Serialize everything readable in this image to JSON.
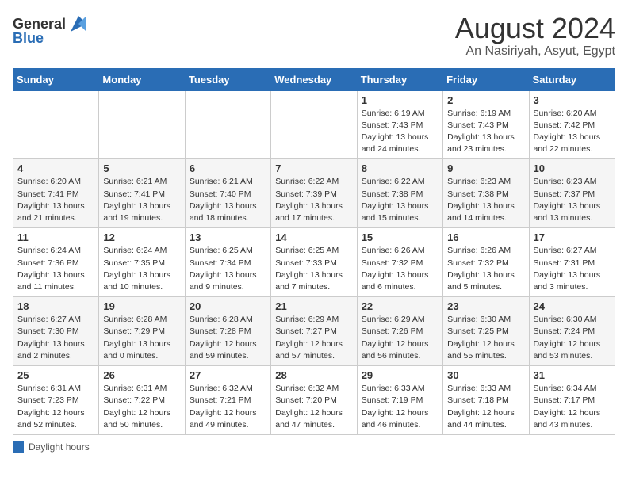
{
  "header": {
    "logo_general": "General",
    "logo_blue": "Blue",
    "month_year": "August 2024",
    "location": "An Nasiriyah, Asyut, Egypt"
  },
  "calendar": {
    "weekdays": [
      "Sunday",
      "Monday",
      "Tuesday",
      "Wednesday",
      "Thursday",
      "Friday",
      "Saturday"
    ],
    "weeks": [
      [
        {
          "day": "",
          "info": ""
        },
        {
          "day": "",
          "info": ""
        },
        {
          "day": "",
          "info": ""
        },
        {
          "day": "",
          "info": ""
        },
        {
          "day": "1",
          "info": "Sunrise: 6:19 AM\nSunset: 7:43 PM\nDaylight: 13 hours\nand 24 minutes."
        },
        {
          "day": "2",
          "info": "Sunrise: 6:19 AM\nSunset: 7:43 PM\nDaylight: 13 hours\nand 23 minutes."
        },
        {
          "day": "3",
          "info": "Sunrise: 6:20 AM\nSunset: 7:42 PM\nDaylight: 13 hours\nand 22 minutes."
        }
      ],
      [
        {
          "day": "4",
          "info": "Sunrise: 6:20 AM\nSunset: 7:41 PM\nDaylight: 13 hours\nand 21 minutes."
        },
        {
          "day": "5",
          "info": "Sunrise: 6:21 AM\nSunset: 7:41 PM\nDaylight: 13 hours\nand 19 minutes."
        },
        {
          "day": "6",
          "info": "Sunrise: 6:21 AM\nSunset: 7:40 PM\nDaylight: 13 hours\nand 18 minutes."
        },
        {
          "day": "7",
          "info": "Sunrise: 6:22 AM\nSunset: 7:39 PM\nDaylight: 13 hours\nand 17 minutes."
        },
        {
          "day": "8",
          "info": "Sunrise: 6:22 AM\nSunset: 7:38 PM\nDaylight: 13 hours\nand 15 minutes."
        },
        {
          "day": "9",
          "info": "Sunrise: 6:23 AM\nSunset: 7:38 PM\nDaylight: 13 hours\nand 14 minutes."
        },
        {
          "day": "10",
          "info": "Sunrise: 6:23 AM\nSunset: 7:37 PM\nDaylight: 13 hours\nand 13 minutes."
        }
      ],
      [
        {
          "day": "11",
          "info": "Sunrise: 6:24 AM\nSunset: 7:36 PM\nDaylight: 13 hours\nand 11 minutes."
        },
        {
          "day": "12",
          "info": "Sunrise: 6:24 AM\nSunset: 7:35 PM\nDaylight: 13 hours\nand 10 minutes."
        },
        {
          "day": "13",
          "info": "Sunrise: 6:25 AM\nSunset: 7:34 PM\nDaylight: 13 hours\nand 9 minutes."
        },
        {
          "day": "14",
          "info": "Sunrise: 6:25 AM\nSunset: 7:33 PM\nDaylight: 13 hours\nand 7 minutes."
        },
        {
          "day": "15",
          "info": "Sunrise: 6:26 AM\nSunset: 7:32 PM\nDaylight: 13 hours\nand 6 minutes."
        },
        {
          "day": "16",
          "info": "Sunrise: 6:26 AM\nSunset: 7:32 PM\nDaylight: 13 hours\nand 5 minutes."
        },
        {
          "day": "17",
          "info": "Sunrise: 6:27 AM\nSunset: 7:31 PM\nDaylight: 13 hours\nand 3 minutes."
        }
      ],
      [
        {
          "day": "18",
          "info": "Sunrise: 6:27 AM\nSunset: 7:30 PM\nDaylight: 13 hours\nand 2 minutes."
        },
        {
          "day": "19",
          "info": "Sunrise: 6:28 AM\nSunset: 7:29 PM\nDaylight: 13 hours\nand 0 minutes."
        },
        {
          "day": "20",
          "info": "Sunrise: 6:28 AM\nSunset: 7:28 PM\nDaylight: 12 hours\nand 59 minutes."
        },
        {
          "day": "21",
          "info": "Sunrise: 6:29 AM\nSunset: 7:27 PM\nDaylight: 12 hours\nand 57 minutes."
        },
        {
          "day": "22",
          "info": "Sunrise: 6:29 AM\nSunset: 7:26 PM\nDaylight: 12 hours\nand 56 minutes."
        },
        {
          "day": "23",
          "info": "Sunrise: 6:30 AM\nSunset: 7:25 PM\nDaylight: 12 hours\nand 55 minutes."
        },
        {
          "day": "24",
          "info": "Sunrise: 6:30 AM\nSunset: 7:24 PM\nDaylight: 12 hours\nand 53 minutes."
        }
      ],
      [
        {
          "day": "25",
          "info": "Sunrise: 6:31 AM\nSunset: 7:23 PM\nDaylight: 12 hours\nand 52 minutes."
        },
        {
          "day": "26",
          "info": "Sunrise: 6:31 AM\nSunset: 7:22 PM\nDaylight: 12 hours\nand 50 minutes."
        },
        {
          "day": "27",
          "info": "Sunrise: 6:32 AM\nSunset: 7:21 PM\nDaylight: 12 hours\nand 49 minutes."
        },
        {
          "day": "28",
          "info": "Sunrise: 6:32 AM\nSunset: 7:20 PM\nDaylight: 12 hours\nand 47 minutes."
        },
        {
          "day": "29",
          "info": "Sunrise: 6:33 AM\nSunset: 7:19 PM\nDaylight: 12 hours\nand 46 minutes."
        },
        {
          "day": "30",
          "info": "Sunrise: 6:33 AM\nSunset: 7:18 PM\nDaylight: 12 hours\nand 44 minutes."
        },
        {
          "day": "31",
          "info": "Sunrise: 6:34 AM\nSunset: 7:17 PM\nDaylight: 12 hours\nand 43 minutes."
        }
      ]
    ]
  },
  "legend": {
    "label": "Daylight hours"
  }
}
